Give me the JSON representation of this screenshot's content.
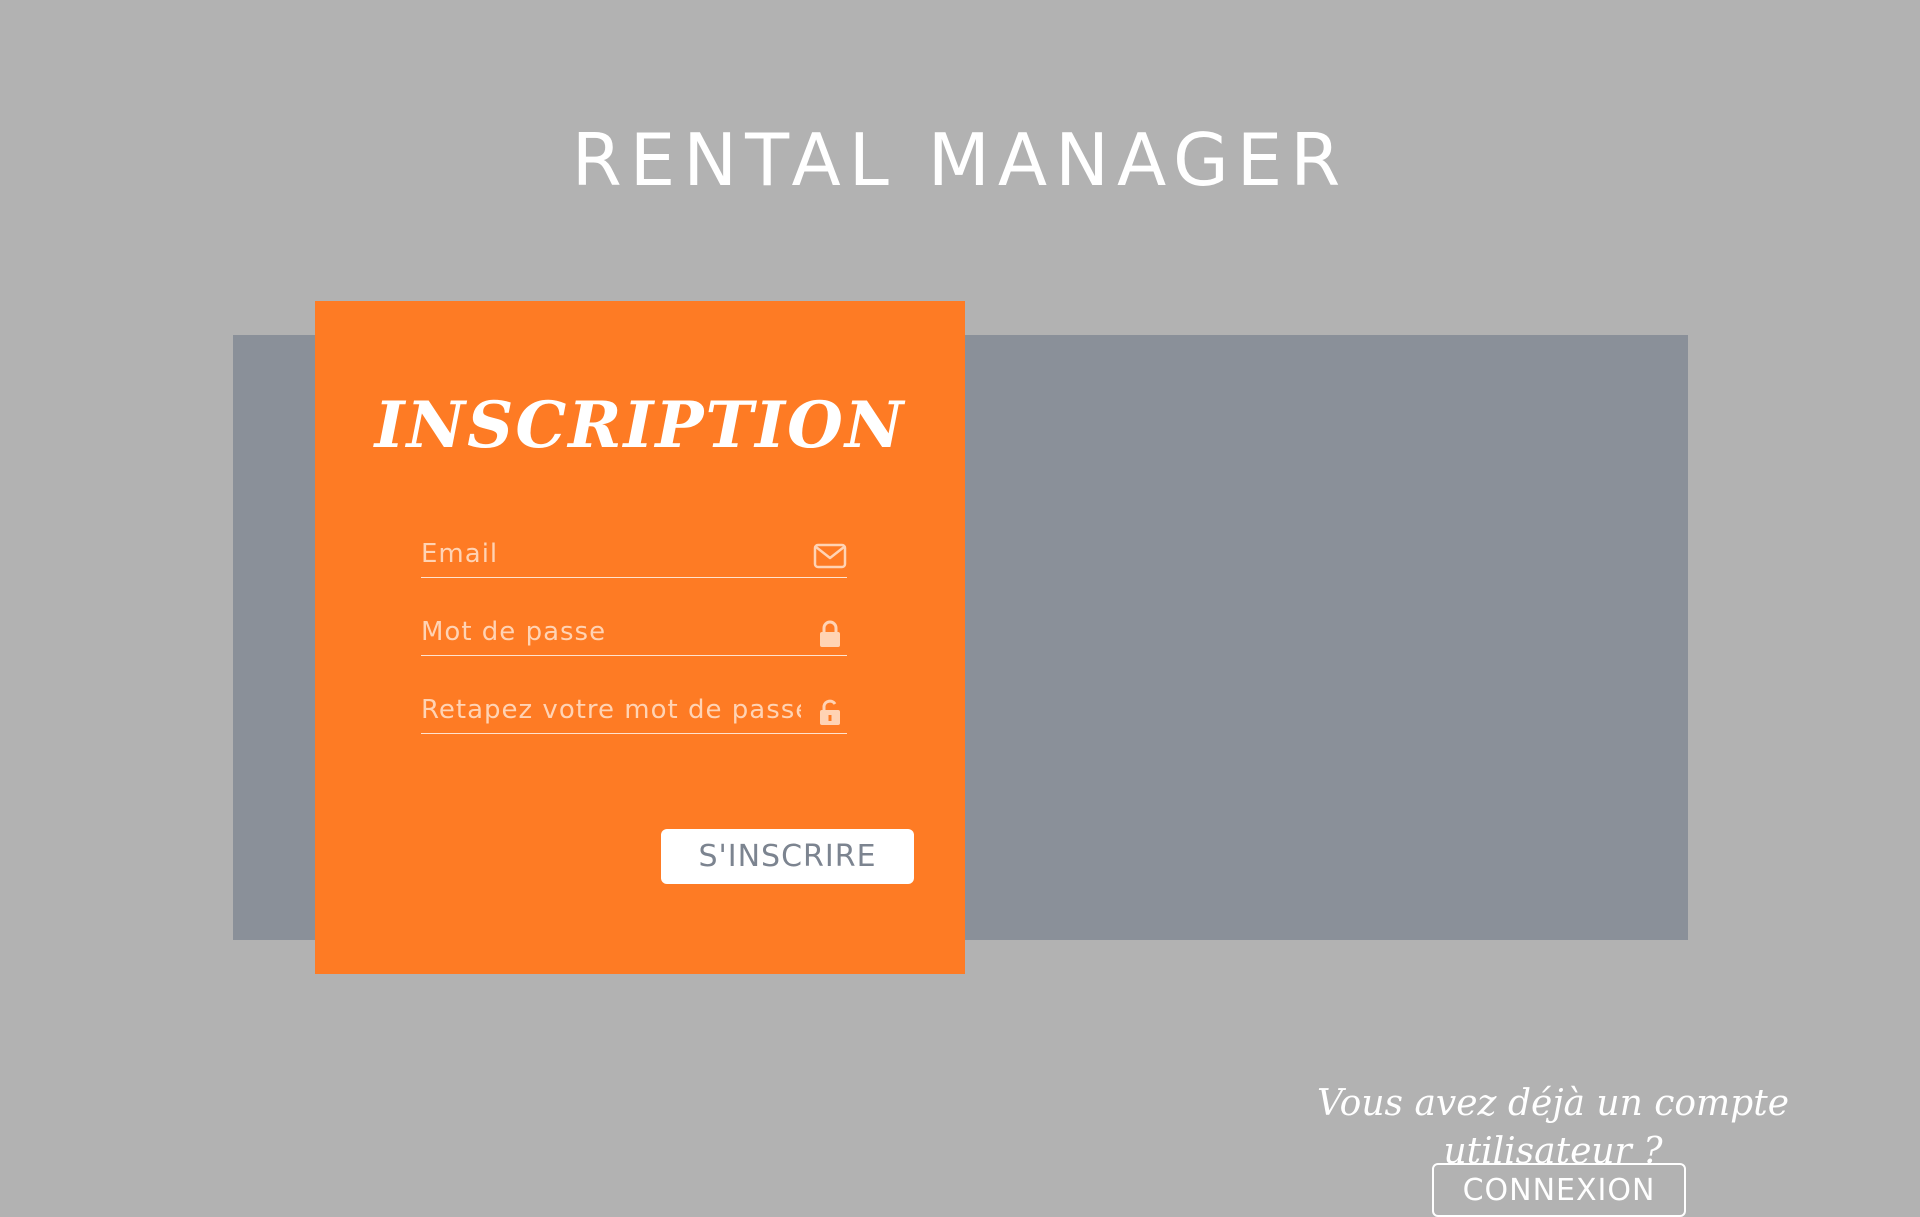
{
  "app": {
    "title": "RENTAL MANAGER"
  },
  "signup_card": {
    "title": "INSCRIPTION",
    "email_placeholder": "Email",
    "email_icon": "envelope-icon",
    "password_placeholder": "Mot de passe",
    "password_icon": "lock-closed-icon",
    "confirm_password_placeholder": "Retapez votre mot de passe",
    "confirm_password_icon": "lock-open-icon",
    "submit_label": "S'INSCRIRE"
  },
  "login_panel": {
    "prompt": "Vous avez déjà un compte utilisateur ?",
    "button_label": "CONNEXION"
  },
  "colors": {
    "background": "#b2b2b2",
    "panel": "#8a9099",
    "accent": "#fe7b24",
    "button_text": "#7c8490"
  }
}
